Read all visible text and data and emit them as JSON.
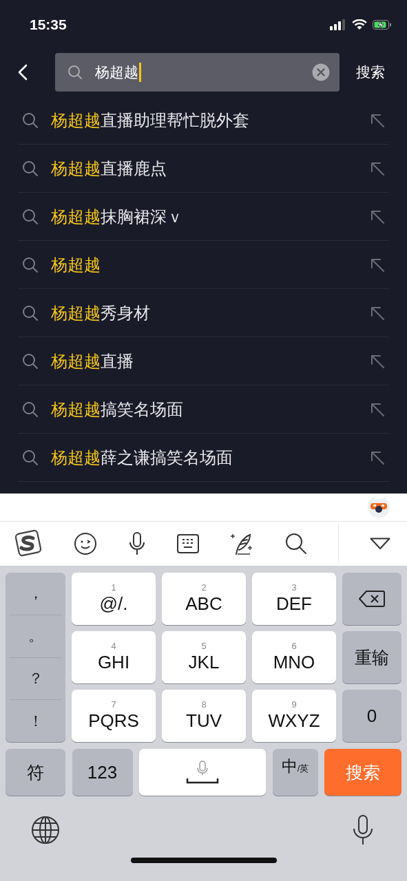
{
  "status_bar": {
    "time": "15:35"
  },
  "search": {
    "query": "杨超越",
    "submit": "搜索"
  },
  "suggestions": [
    {
      "match": "杨超越",
      "rest": "直播助理帮忙脱外套"
    },
    {
      "match": "杨超越",
      "rest": "直播鹿点"
    },
    {
      "match": "杨超越",
      "rest": "抹胸裙深ｖ"
    },
    {
      "match": "杨超越"
    },
    {
      "match": "杨超越",
      "rest": "秀身材"
    },
    {
      "match": "杨超越",
      "rest": "直播"
    },
    {
      "match": "杨超越",
      "rest": "搞笑名场面"
    },
    {
      "match": "杨超越",
      "rest": "薛之谦搞笑名场面"
    }
  ],
  "keyboard": {
    "symbols": [
      "，",
      "。",
      "？",
      "！"
    ],
    "keys": [
      {
        "digit": "1",
        "letters": "@/."
      },
      {
        "digit": "2",
        "letters": "ABC"
      },
      {
        "digit": "3",
        "letters": "DEF"
      },
      {
        "digit": "4",
        "letters": "GHI"
      },
      {
        "digit": "5",
        "letters": "JKL"
      },
      {
        "digit": "6",
        "letters": "MNO"
      },
      {
        "digit": "7",
        "letters": "PQRS"
      },
      {
        "digit": "8",
        "letters": "TUV"
      },
      {
        "digit": "9",
        "letters": "WXYZ"
      }
    ],
    "retype": "重输",
    "zero": "0",
    "symbol_key": "符",
    "number_key": "123",
    "lang_key": {
      "label": "中",
      "sublabel": "/英"
    },
    "search_key": "搜索"
  }
}
